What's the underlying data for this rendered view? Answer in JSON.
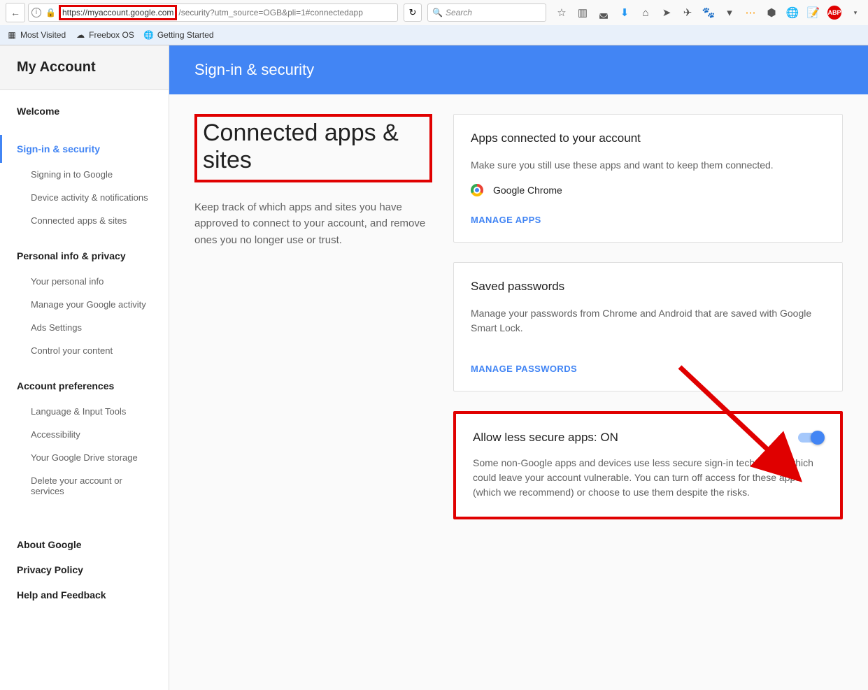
{
  "browser": {
    "url_prefix": "https://myaccount.google.com",
    "url_suffix": "/security?utm_source=OGB&pli=1#connectedapp",
    "search_placeholder": "Search",
    "bookmarks": [
      {
        "label": "Most Visited",
        "icon": "grid"
      },
      {
        "label": "Freebox OS",
        "icon": "cloud"
      },
      {
        "label": "Getting Started",
        "icon": "globe"
      }
    ]
  },
  "sidebar": {
    "title": "My Account",
    "groups": [
      {
        "head": "Welcome",
        "active": false,
        "items": []
      },
      {
        "head": "Sign-in & security",
        "active": true,
        "items": [
          "Signing in to Google",
          "Device activity & notifications",
          "Connected apps & sites"
        ]
      },
      {
        "head": "Personal info & privacy",
        "active": false,
        "items": [
          "Your personal info",
          "Manage your Google activity",
          "Ads Settings",
          "Control your content"
        ]
      },
      {
        "head": "Account preferences",
        "active": false,
        "items": [
          "Language & Input Tools",
          "Accessibility",
          "Your Google Drive storage",
          "Delete your account or services"
        ]
      }
    ],
    "footer_links": [
      "About Google",
      "Privacy Policy",
      "Help and Feedback"
    ]
  },
  "header": {
    "title": "Sign-in & security"
  },
  "main": {
    "title": "Connected apps & sites",
    "intro": "Keep track of which apps and sites you have approved to connect to your account, and remove ones you no longer use or trust."
  },
  "cards": {
    "connected": {
      "title": "Apps connected to your account",
      "desc": "Make sure you still use these apps and want to keep them connected.",
      "app": "Google Chrome",
      "action": "MANAGE APPS"
    },
    "passwords": {
      "title": "Saved passwords",
      "desc": "Manage your passwords from Chrome and Android that are saved with Google Smart Lock.",
      "action": "MANAGE PASSWORDS"
    },
    "less_secure": {
      "title": "Allow less secure apps: ON",
      "desc": "Some non-Google apps and devices use less secure sign-in technology, which could leave your account vulnerable. You can turn off access for these apps (which we recommend) or choose to use them despite the risks."
    }
  }
}
